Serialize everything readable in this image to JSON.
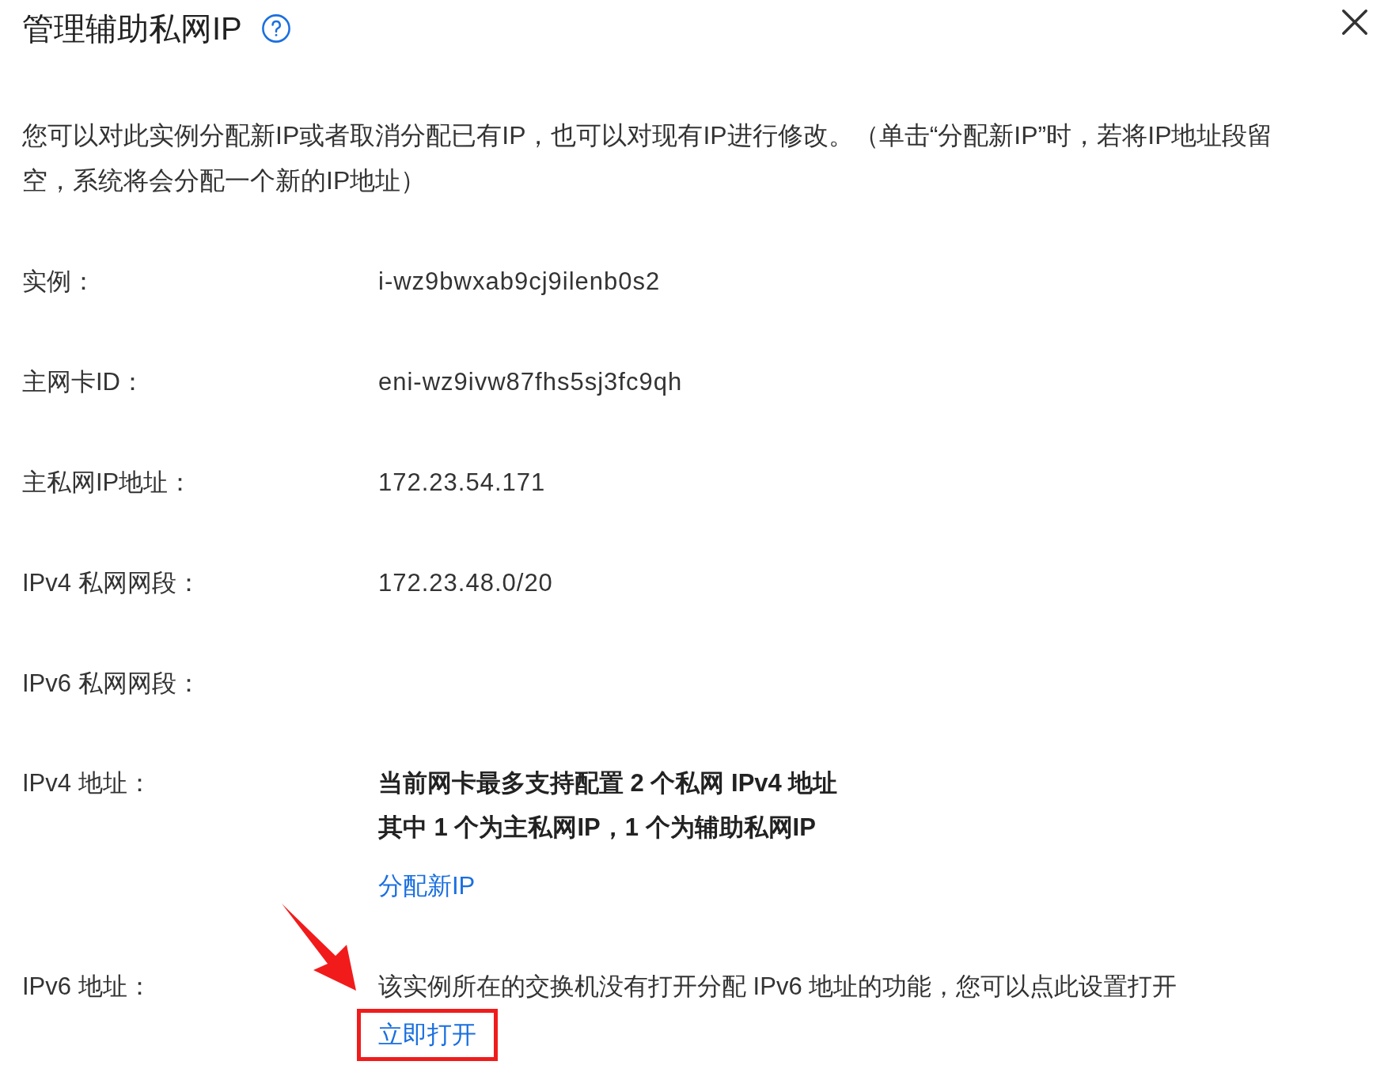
{
  "dialog": {
    "title": "管理辅助私网IP",
    "description": "您可以对此实例分配新IP或者取消分配已有IP，也可以对现有IP进行修改。（单击“分配新IP”时，若将IP地址段留空，系统将会分配一个新的IP地址）"
  },
  "fields": [
    {
      "label": "实例：",
      "value": "i-wz9bwxab9cj9ilenb0s2"
    },
    {
      "label": "主网卡ID：",
      "value": "eni-wz9ivw87fhs5sj3fc9qh"
    },
    {
      "label": "主私网IP地址：",
      "value": "172.23.54.171"
    },
    {
      "label": "IPv4 私网网段：",
      "value": "172.23.48.0/20"
    },
    {
      "label": "IPv6 私网网段："
    }
  ],
  "ipv4": {
    "label": "IPv4 地址：",
    "lines": [
      "当前网卡最多支持配置 2 个私网 IPv4 地址",
      "其中 1 个为主私网IP，1 个为辅助私网IP"
    ],
    "link": "分配新IP"
  },
  "ipv6": {
    "label": "IPv6 地址：",
    "text": "该实例所在的交换机没有打开分配 IPv6 地址的功能，您可以点此设置打开",
    "link": "立即打开"
  }
}
